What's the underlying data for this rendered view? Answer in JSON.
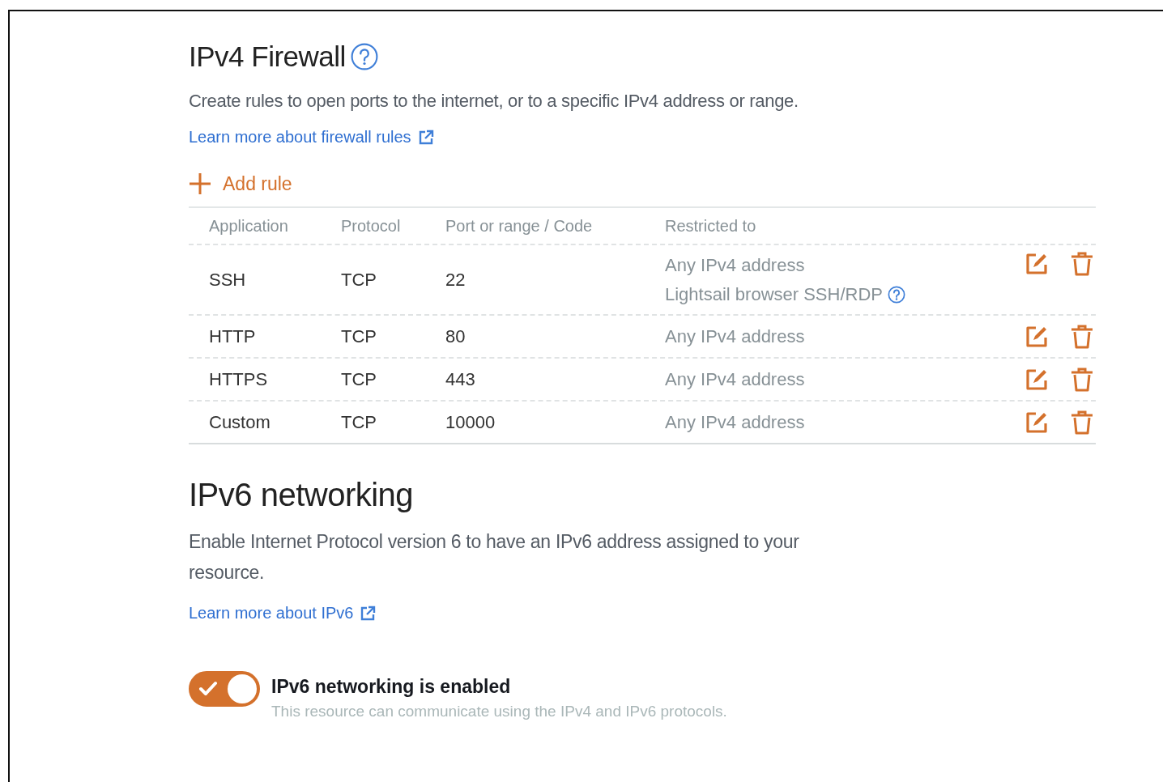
{
  "firewall": {
    "title": "IPv4 Firewall",
    "description": "Create rules to open ports to the internet, or to a specific IPv4 address or range.",
    "link": "Learn more about firewall rules",
    "add_rule": "Add rule",
    "columns": [
      "Application",
      "Protocol",
      "Port or range / Code",
      "Restricted to"
    ],
    "rows": [
      {
        "application": "SSH",
        "protocol": "TCP",
        "port": "22",
        "restricted": [
          {
            "text": "Any IPv4 address",
            "help": false
          },
          {
            "text": "Lightsail browser SSH/RDP",
            "help": true
          }
        ]
      },
      {
        "application": "HTTP",
        "protocol": "TCP",
        "port": "80",
        "restricted": [
          {
            "text": "Any IPv4 address",
            "help": false
          }
        ]
      },
      {
        "application": "HTTPS",
        "protocol": "TCP",
        "port": "443",
        "restricted": [
          {
            "text": "Any IPv4 address",
            "help": false
          }
        ]
      },
      {
        "application": "Custom",
        "protocol": "TCP",
        "port": "10000",
        "restricted": [
          {
            "text": "Any IPv4 address",
            "help": false
          }
        ]
      }
    ]
  },
  "ipv6": {
    "title": "IPv6 networking",
    "description": "Enable Internet Protocol version 6 to have an IPv6 address assigned to your resource.",
    "link": "Learn more about IPv6",
    "toggle": {
      "on": true,
      "label": "IPv6 networking is enabled",
      "hint": "This resource can communicate using the IPv4 and IPv6 protocols."
    }
  }
}
